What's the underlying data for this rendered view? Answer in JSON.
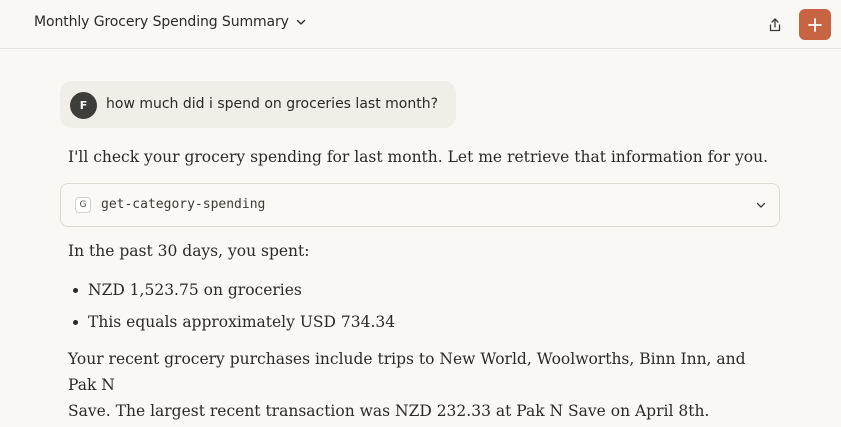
{
  "header": {
    "title": "Monthly Grocery Spending Summary",
    "title_icon": "chevron-down-icon",
    "share_icon": "share-icon",
    "new_chat_icon": "plus-icon",
    "accent_color": "#c96442"
  },
  "conversation": {
    "user_message": {
      "avatar_initial": "F",
      "text": "how much did i spend on groceries last month?"
    },
    "assistant": {
      "intro": "I'll check your grocery spending for last month. Let me retrieve that information for you.",
      "tool_call": {
        "badge": "G",
        "name": "get-category-spending",
        "expand_icon": "chevron-down-icon"
      },
      "summary": "In the past 30 days, you spent:",
      "bullets": [
        "NZD 1,523.75 on groceries",
        "This equals approximately USD 734.34"
      ],
      "recent_line_1": "Your recent grocery purchases include trips to New World, Woolworths, Binn Inn, and Pak N",
      "recent_line_2": "Save. The largest recent transaction was NZD 232.33 at Pak N Save on April 8th."
    }
  }
}
